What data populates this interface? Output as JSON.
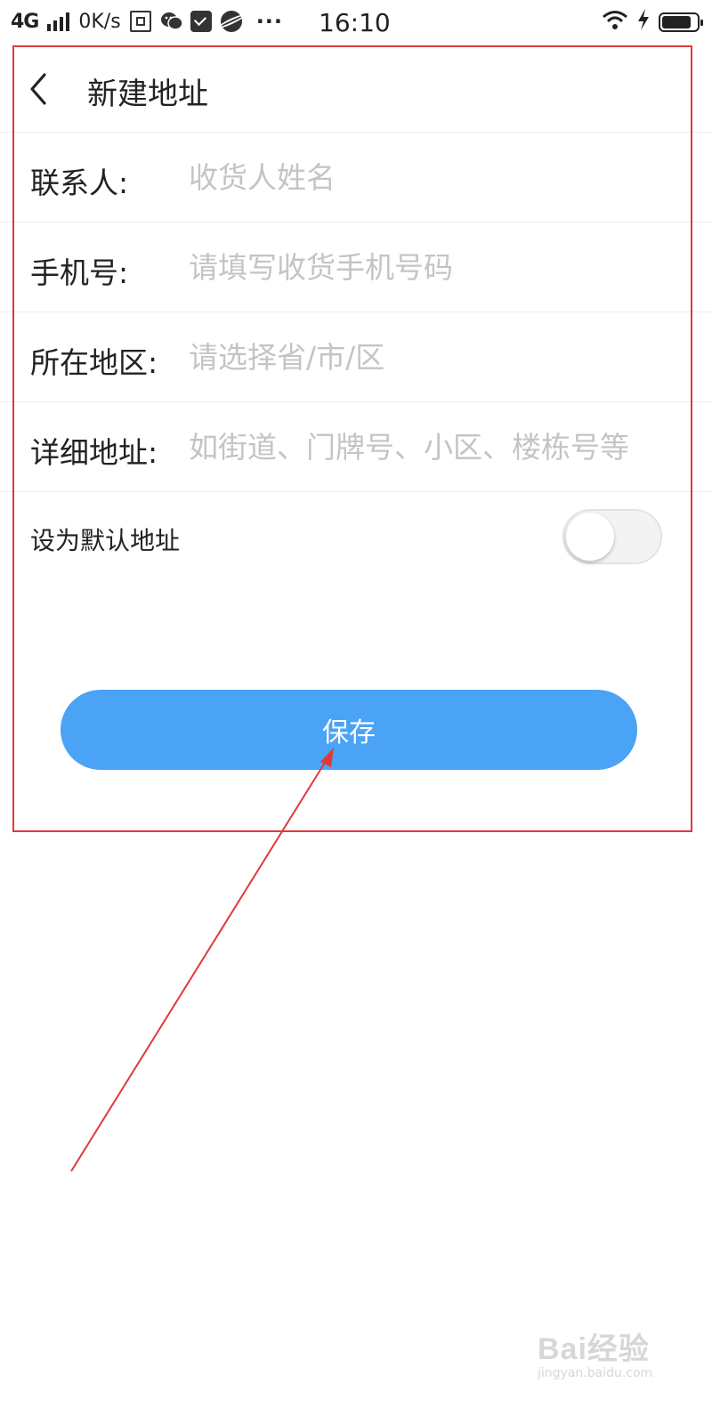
{
  "status_bar": {
    "network": "4G",
    "speed": "0K/s",
    "time": "16:10",
    "more": "···",
    "icons": [
      "signal-icon",
      "storage-icon",
      "wechat-icon",
      "mail-icon",
      "browser-icon",
      "wifi-icon",
      "charging-icon",
      "battery-icon"
    ],
    "battery_level": 0.85
  },
  "header": {
    "title": "新建地址",
    "back_icon": "chevron-left-icon"
  },
  "form": {
    "fields": [
      {
        "label": "联系人:",
        "value": "",
        "placeholder": "收货人姓名"
      },
      {
        "label": "手机号:",
        "value": "",
        "placeholder": "请填写收货手机号码"
      },
      {
        "label": "所在地区:",
        "value": "",
        "placeholder": "请选择省/市/区"
      },
      {
        "label": "详细地址:",
        "value": "",
        "placeholder": "如街道、门牌号、小区、楼栋号等"
      }
    ],
    "default_address_label": "设为默认地址",
    "default_address_on": false
  },
  "save_label": "保存",
  "colors": {
    "primary": "#4aa3f4",
    "annotation": "#e0393b",
    "placeholder": "#c4c4c4"
  },
  "watermark": {
    "brand": "Bai经验",
    "url": "jingyan.baidu.com"
  }
}
